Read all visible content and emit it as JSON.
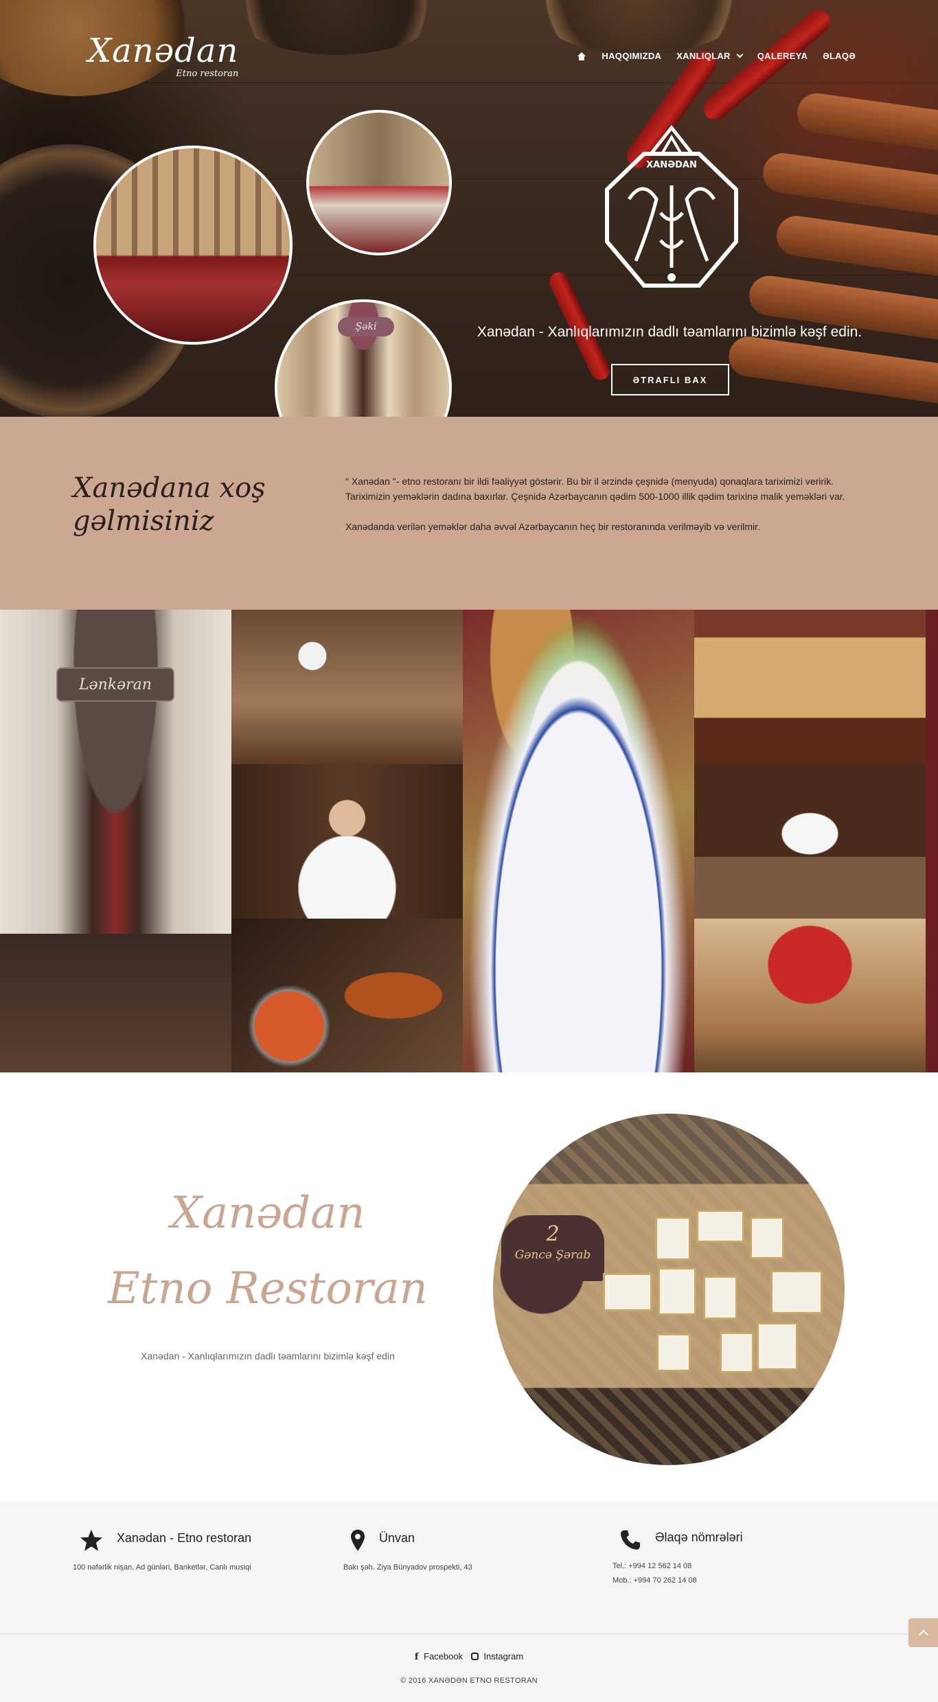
{
  "brand": {
    "name": "Xanədan",
    "subtitle": "Etno restoran"
  },
  "nav": {
    "home_icon": "home-icon",
    "items": [
      {
        "label": "HAQQIMIZDA"
      },
      {
        "label": "XANLIQLAR",
        "has_dropdown": true
      },
      {
        "label": "QALEREYA"
      },
      {
        "label": "ƏLAQƏ"
      }
    ]
  },
  "hero": {
    "emblem_text": "XANƏDAN",
    "plaque_text": "Şəki",
    "tagline": "Xanədan - Xanlıqlarımızın dadlı təamlarını bizimlə kəşf edin.",
    "button_label": "ƏTRAFLI BAX"
  },
  "welcome": {
    "title": "Xanədana xoş gəlmisiniz",
    "paragraph1": "\" Xanədan \"- etno restoranı bir ildi fəaliyyət göstərir. Bu bir il ərzində çeşnidə (menyuda) qonaqlara tariximizi veririk. Tariximizin yeməklərin dadına baxırlar. Çeşnidə Azərbaycanın qədim 500-1000 illik qədim tarixinə malik yeməkləri var.",
    "paragraph2": "Xanədanda verilən yeməklər daha əvvəl Azərbaycanın heç bir restoranında verilməyib və verilmir."
  },
  "gallery": {
    "sign_text": "Lənkəran"
  },
  "promo": {
    "title_line1": "Xanədan",
    "title_line2": "Etno Restoran",
    "subtitle": "Xanədan - Xanlıqlarımızın dadlı təamlarını bizimlə kəşf edin",
    "sign_number": "2",
    "sign_text": "Gəncə Şərab"
  },
  "footer": {
    "columns": [
      {
        "icon": "star-icon",
        "title": "Xanədan - Etno restoran",
        "lines": [
          "100 nəfərlik nişan, Ad günləri, Banketlər, Canlı musiqi"
        ]
      },
      {
        "icon": "pin-icon",
        "title": "Ünvan",
        "lines": [
          "Bakı şəh. Ziya Bünyadov prospekti, 43"
        ]
      },
      {
        "icon": "phone-icon",
        "title": "Əlaqə nömrələri",
        "lines": [
          "Tel.: +994 12 562 14 08",
          "Mob.: +994 70 262 14 08"
        ]
      }
    ],
    "social": {
      "facebook": "Facebook",
      "instagram": "Instagram"
    },
    "copyright": "© 2016 XANƏDƏN ETNO RESTORAN"
  },
  "colors": {
    "accent": "#cca893",
    "promo_title": "#c9a692",
    "footer_bg": "#f5f5f5",
    "gallery_edge": "#6b1e22"
  }
}
